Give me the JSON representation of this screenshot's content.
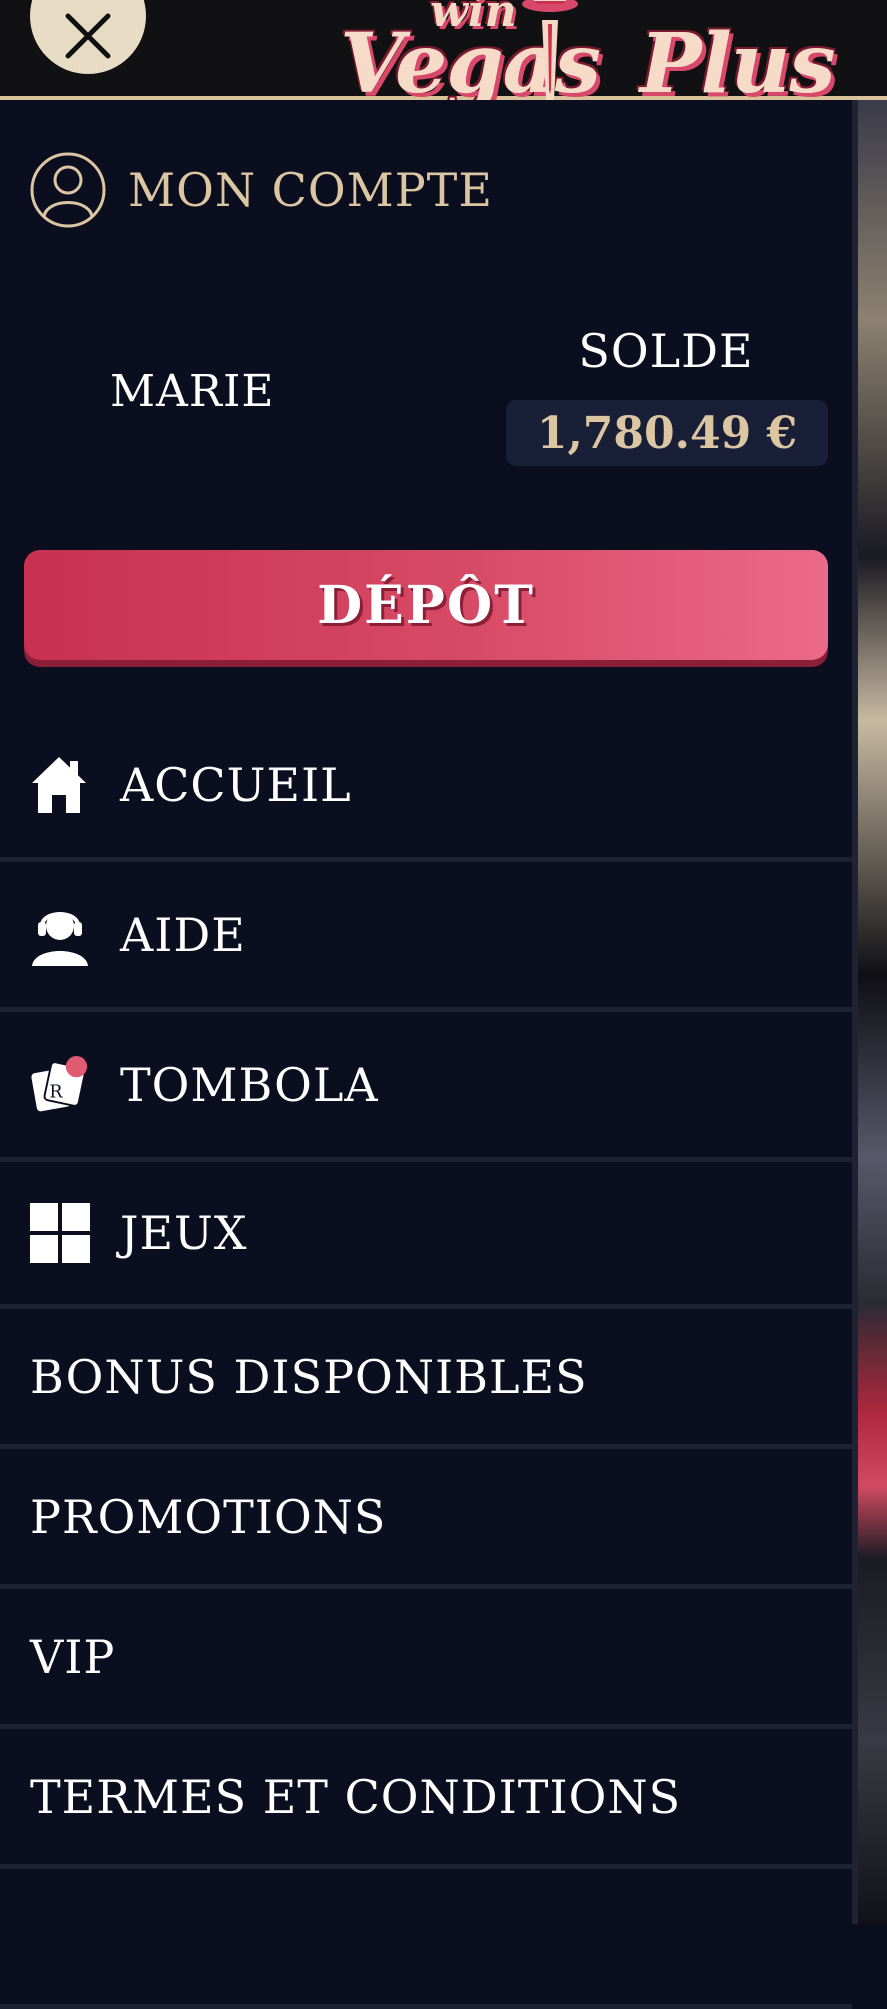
{
  "header": {
    "logo_small": "win",
    "logo_word1": "Vegas",
    "logo_word2": "Plus"
  },
  "account": {
    "title": "MON COMPTE",
    "username": "MARIE",
    "balance_label": "SOLDE",
    "balance_value": "1,780.49 €"
  },
  "deposit_label": "DÉPÔT",
  "menu": {
    "home": "ACCUEIL",
    "help": "AIDE",
    "tombola": "TOMBOLA",
    "games": "JEUX",
    "bonus": "BONUS DISPONIBLES",
    "promotions": "PROMOTIONS",
    "vip": "VIP",
    "terms": "TERMES ET CONDITIONS"
  },
  "colors": {
    "background": "#0a0e1f",
    "gold": "#dcc6a2",
    "accent": "#d74a66"
  },
  "icons": [
    "close-icon",
    "user-icon",
    "home-icon",
    "support-icon",
    "tombola-icon",
    "grid-icon"
  ]
}
